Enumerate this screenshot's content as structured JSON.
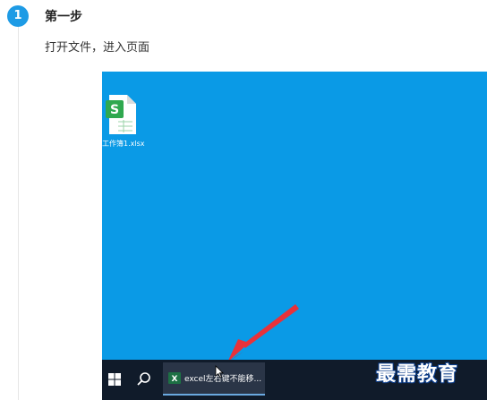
{
  "step": {
    "number": "1",
    "title": "第一步",
    "description": "打开文件，进入页面"
  },
  "screenshot": {
    "desktop_icon": {
      "icon": "spreadsheet-file-icon",
      "badge_letter": "S",
      "label": "工作簿1.xlsx"
    },
    "taskbar": {
      "start_icon": "windows-logo-icon",
      "search_icon": "search-icon",
      "active_item": {
        "icon": "excel-icon",
        "icon_letter": "X",
        "label": "excel左右键不能移..."
      }
    },
    "watermark": "最需教育",
    "colors": {
      "desktop": "#0a9ae6",
      "taskbar": "#101b2a",
      "badge": "#1e9be5",
      "arrow": "#e8323a"
    }
  }
}
